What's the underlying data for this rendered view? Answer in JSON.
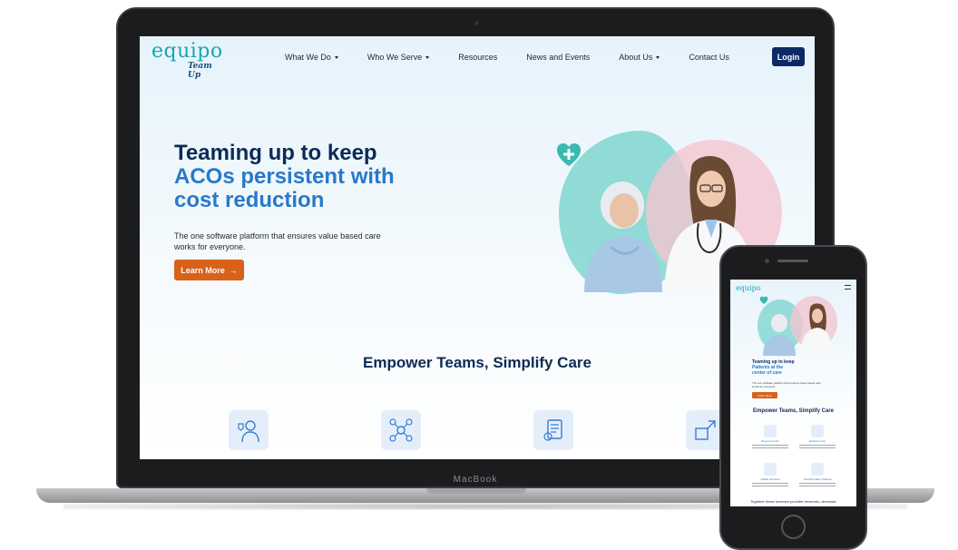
{
  "device": {
    "laptop_brand": "MacBook"
  },
  "site": {
    "logo": {
      "name": "equipo",
      "tagline": "Team Up"
    },
    "nav": {
      "items": [
        {
          "label": "What We Do",
          "dropdown": true
        },
        {
          "label": "Who We Serve",
          "dropdown": true
        },
        {
          "label": "Resources",
          "dropdown": false
        },
        {
          "label": "News and Events",
          "dropdown": false
        },
        {
          "label": "About Us",
          "dropdown": true
        },
        {
          "label": "Contact Us",
          "dropdown": false
        }
      ],
      "login_label": "Login"
    },
    "hero": {
      "title_line1": "Teaming up to keep",
      "title_line2": "ACOs persistent with",
      "title_line3": "cost reduction",
      "description": "The one software platform that ensures value based care works for everyone.",
      "cta_label": "Learn More",
      "cta_arrow": "→"
    },
    "section_title": "Empower Teams, Simplify Care"
  },
  "mobile": {
    "logo": "equipo",
    "hero": {
      "title_line1": "Teaming up to keep",
      "title_line2": "Patients at the",
      "title_line3": "center of care",
      "description": "The one software platform that ensures value based care works for everyone.",
      "cta_label": "Learn More"
    },
    "section_title": "Empower Teams, Simplify Care",
    "cards": [
      {
        "title": "Payers Centric"
      },
      {
        "title": "Evidence first"
      },
      {
        "title": "Stable Focused"
      },
      {
        "title": "Transformative Patients"
      }
    ],
    "footer_text": "Together these increase provider revenues, decrease"
  },
  "colors": {
    "brand_teal": "#1ba5b0",
    "navy": "#0d2a55",
    "accent_blue": "#2a79c9",
    "cta_orange": "#d8621a",
    "login_navy": "#0c2b66"
  }
}
